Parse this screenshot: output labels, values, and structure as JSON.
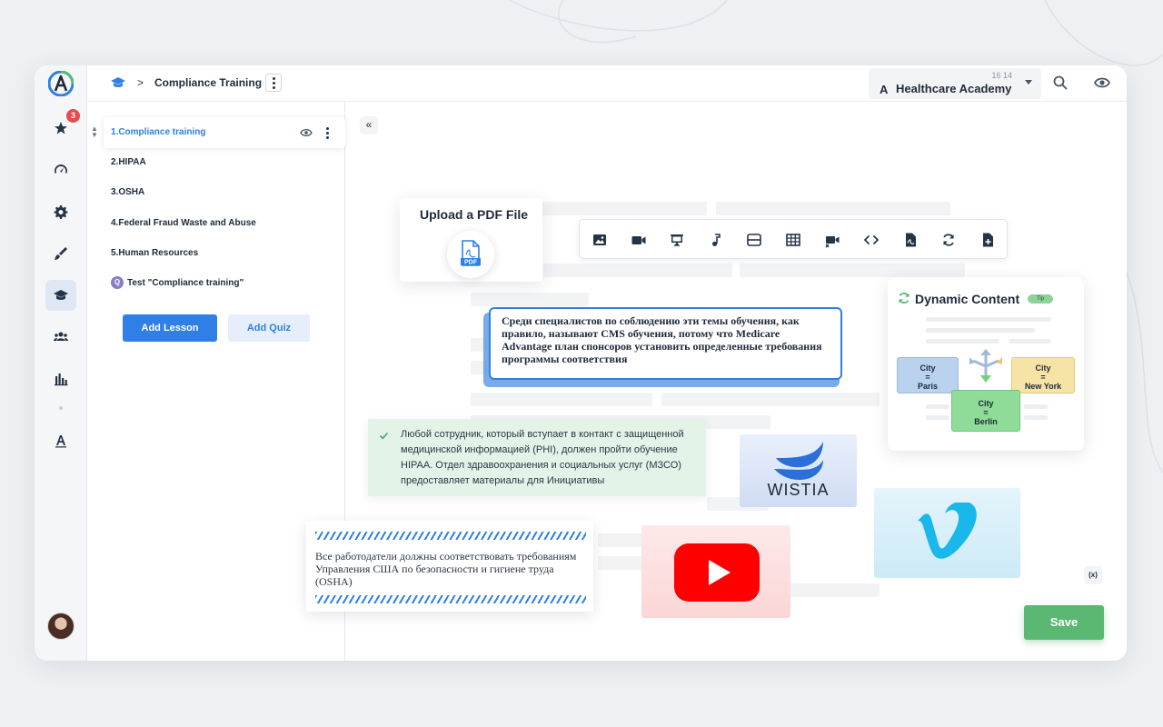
{
  "breadcrumb": {
    "separator": ">",
    "title": "Compliance Training"
  },
  "rail": {
    "badge_count": "3"
  },
  "academy": {
    "stats": "16   14",
    "name": "Healthcare Academy",
    "logo_letter": "A"
  },
  "lessons": [
    {
      "label": "1.Compliance training"
    },
    {
      "label": "2.HIPAA"
    },
    {
      "label": "3.OSHA"
    },
    {
      "label": "4.Federal Fraud Waste and Abuse"
    },
    {
      "label": "5.Human Resources"
    }
  ],
  "quiz": {
    "badge": "Q",
    "label": "Test \"Compliance training\""
  },
  "buttons": {
    "add_lesson": "Add Lesson",
    "add_quiz": "Add Quiz",
    "save": "Save",
    "collapse": "«",
    "variables": "(x)"
  },
  "upload": {
    "title": "Upload a PDF File",
    "pdf_label": "PDF"
  },
  "toolbar": {
    "tools": [
      "image-icon",
      "video-icon",
      "presentation-icon",
      "audio-icon",
      "divider-icon",
      "table-icon",
      "video-record-icon",
      "code-icon",
      "pdf-icon",
      "refresh-icon",
      "add-file-icon"
    ]
  },
  "quote_text": "Среди специалистов по соблюдению эти темы обучения, как правило, называют CMS обучения, потому что Medicare Advantage план спонсоров установить определенные требования программы соответствия",
  "green_note": "Любой сотрудник, который вступает в контакт с защищенной медицинской информацией (PHI), должен пройти обучение HIPAA. Отдел здравоохранения и социальных услуг (МЗСО) предоставляет материалы для Инициативы",
  "hatch_note": "Все работодатели должны соответствовать требованиям Управления США по безопасности и гигиене труда (OSHA)",
  "dynamic_content": {
    "title": "Dynamic Content",
    "tip": "Tip",
    "cities": [
      {
        "key": "City",
        "eq": "=",
        "value": "Paris",
        "color": "#b9d2ee"
      },
      {
        "key": "City",
        "eq": "=",
        "value": "New York",
        "color": "#f6e3a6"
      },
      {
        "key": "City",
        "eq": "=",
        "value": "Berlin",
        "color": "#8fdc98"
      }
    ]
  },
  "media": {
    "wistia": "WISTIA",
    "vimeo": "vimeo",
    "youtube": "youtube"
  },
  "colors": {
    "accent": "#2f7fe6",
    "save": "#5bb872",
    "badge": "#e74c4c"
  }
}
